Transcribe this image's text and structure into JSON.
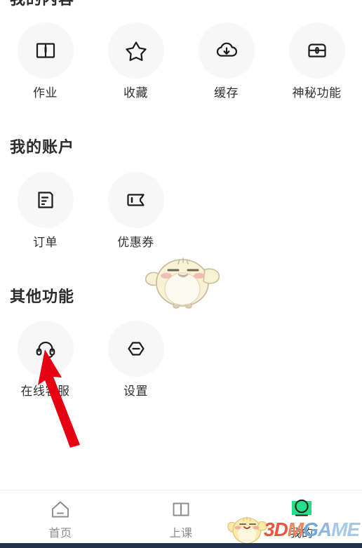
{
  "app": {
    "background": "#ffffff",
    "accent_green": "#25e08a",
    "annotation_color": "#e60012"
  },
  "sections": [
    {
      "title": "我的内容",
      "items": [
        {
          "label": "作业",
          "icon": "book-icon"
        },
        {
          "label": "收藏",
          "icon": "star-icon"
        },
        {
          "label": "缓存",
          "icon": "cloud-download-icon"
        },
        {
          "label": "神秘功能",
          "icon": "treasure-chest-icon"
        }
      ]
    },
    {
      "title": "我的账户",
      "items": [
        {
          "label": "订单",
          "icon": "receipt-icon"
        },
        {
          "label": "优惠券",
          "icon": "coupon-ticket-icon"
        }
      ]
    },
    {
      "title": "其他功能",
      "items": [
        {
          "label": "在线客服",
          "icon": "headset-icon"
        },
        {
          "label": "设置",
          "icon": "settings-hexagon-icon"
        }
      ]
    }
  ],
  "annotation": {
    "type": "red-arrow",
    "points_to": "在线客服",
    "color": "#e60012"
  },
  "mascot": {
    "name": "yellow-chick-mascot",
    "body_color": "#f7f0cd",
    "outline_color": "#cdbda0"
  },
  "tabbar": {
    "tabs": [
      {
        "label": "首页",
        "icon": "house-icon",
        "active": false
      },
      {
        "label": "上课",
        "icon": "open-book-icon",
        "active": false
      },
      {
        "label": "我的",
        "icon": "profile-person-icon",
        "active": true
      }
    ]
  },
  "watermark": {
    "text_3d": "3D",
    "text_m": "M",
    "text_g": "G",
    "text_am": "A",
    "text_me": "ME"
  }
}
